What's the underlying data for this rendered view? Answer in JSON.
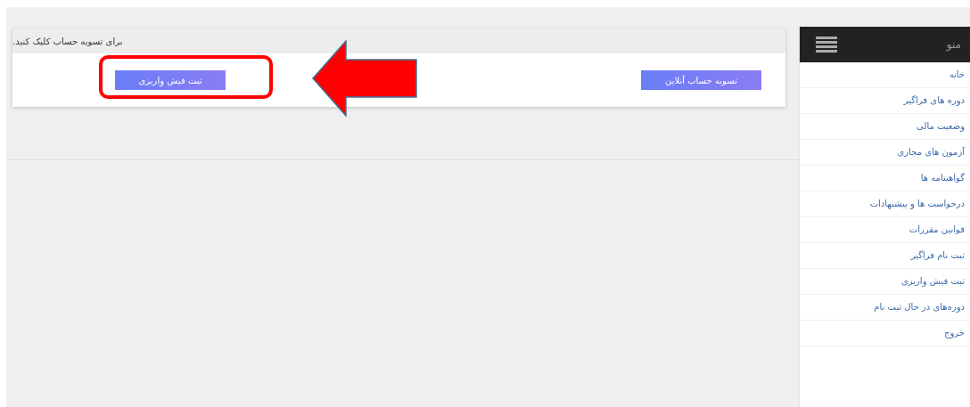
{
  "card": {
    "message": "برای تسویه حساب کلیک کنید.",
    "buttons": [
      "تسویه حساب آنلاین",
      "ثبت فیش واریزی"
    ]
  },
  "sidebar": {
    "title": "منو",
    "items": [
      {
        "label": "خانه"
      },
      {
        "label": "دوره های فراگیر"
      },
      {
        "label": "وضعیت مالی"
      },
      {
        "label": "آزمون های مجازی"
      },
      {
        "label": "گواهینامه ها"
      },
      {
        "label": "درخواست ها و پیشنهادات"
      },
      {
        "label": "قوانین مقررات"
      },
      {
        "label": "ثبت نام فراگیر"
      },
      {
        "label": "ثبت فیش واریزی"
      },
      {
        "label": "دوره‌های در حال ثبت نام"
      },
      {
        "label": "خروج"
      }
    ]
  }
}
